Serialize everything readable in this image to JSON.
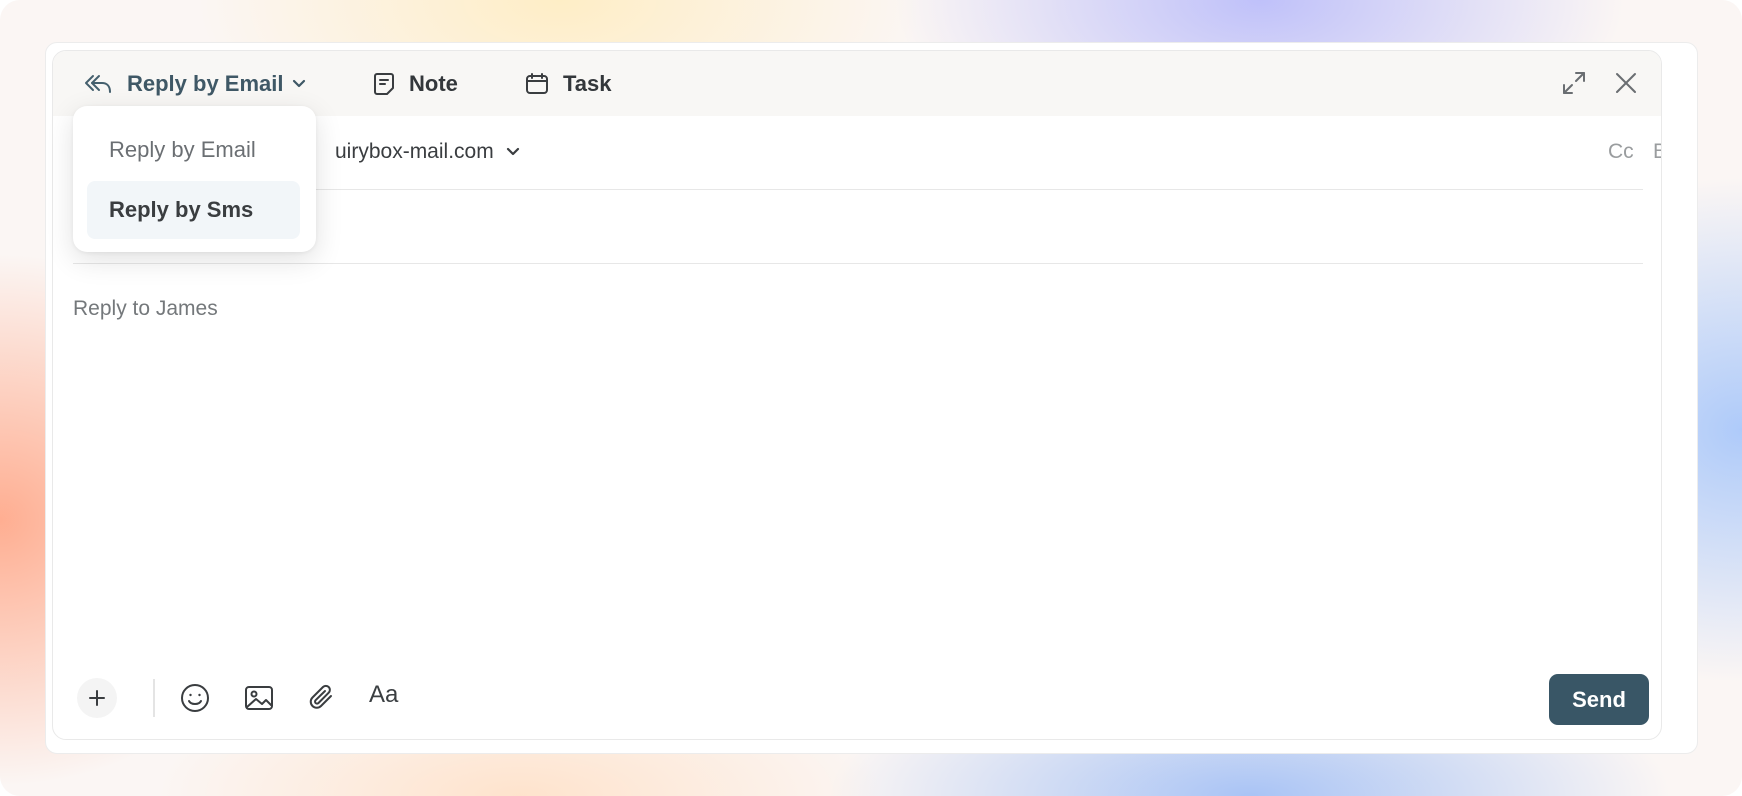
{
  "composer": {
    "tabs": {
      "reply": "Reply by Email",
      "note": "Note",
      "task": "Task"
    },
    "from_value": "uirybox-mail.com",
    "cc_label": "Cc",
    "bcc_label": "Bcc",
    "body_placeholder": "Reply to James",
    "format_label": "Aa",
    "send_label": "Send"
  },
  "dropdown": {
    "options": [
      "Reply by Email",
      "Reply by Sms"
    ],
    "highlighted": "Reply by Sms"
  },
  "icons": {
    "reply": "reply-arrow-icon",
    "note": "note-icon",
    "task": "calendar-icon",
    "expand": "expand-icon",
    "close": "close-icon",
    "plus": "plus-icon",
    "emoji": "emoji-icon",
    "image": "image-icon",
    "attach": "paperclip-icon"
  },
  "colors": {
    "accent": "#395666",
    "send_text": "#ffffff",
    "highlight_bg": "#f2f6f9"
  }
}
